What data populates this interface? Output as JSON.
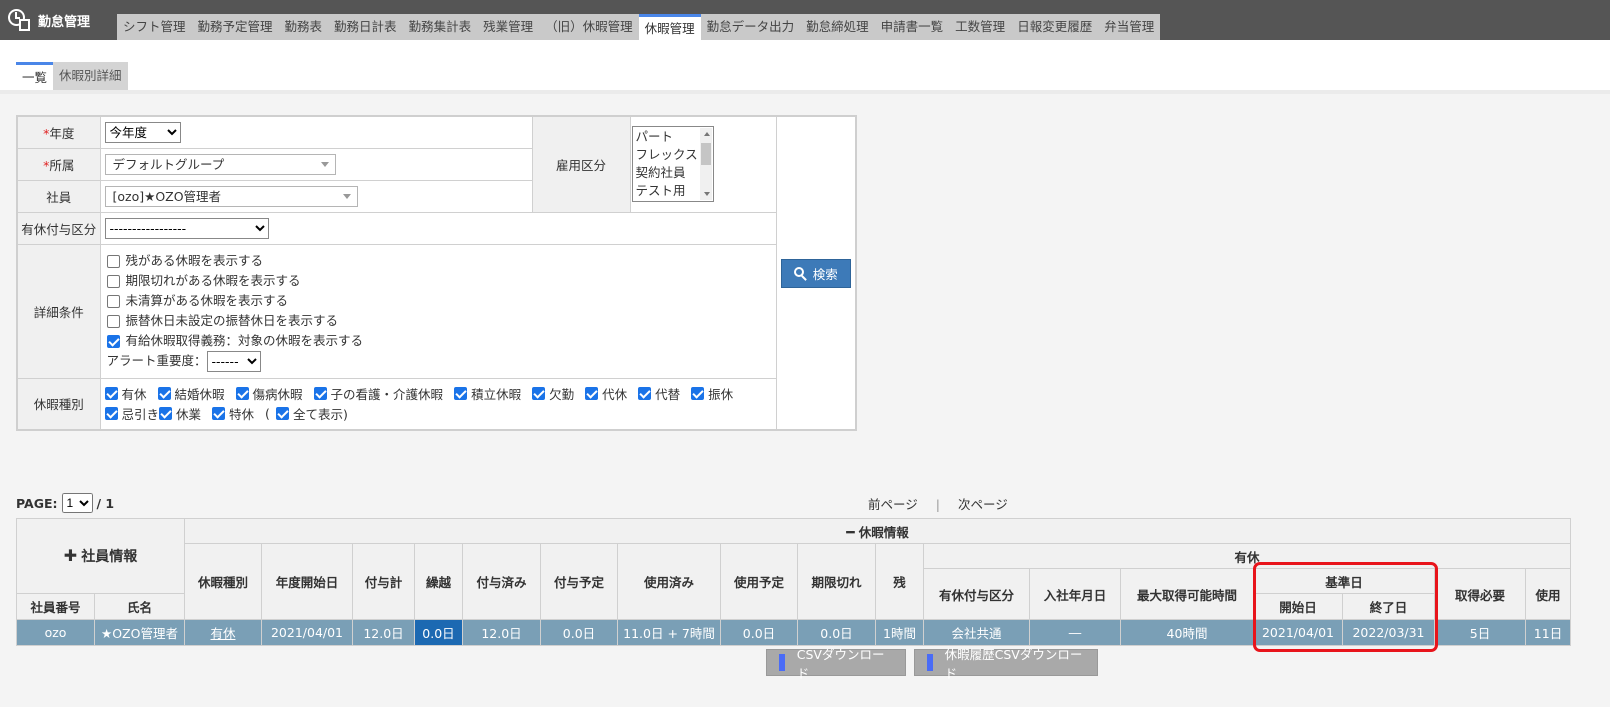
{
  "app": {
    "title": "勤怠管理",
    "icon": "clock-document-icon"
  },
  "nav": {
    "tabs": [
      {
        "label": "シフト管理",
        "active": false
      },
      {
        "label": "勤務予定管理",
        "active": false
      },
      {
        "label": "勤務表",
        "active": false
      },
      {
        "label": "勤務日計表",
        "active": false
      },
      {
        "label": "勤務集計表",
        "active": false
      },
      {
        "label": "残業管理",
        "active": false
      },
      {
        "label": "（旧）休暇管理",
        "active": false
      },
      {
        "label": "休暇管理",
        "active": true
      },
      {
        "label": "勤怠データ出力",
        "active": false
      },
      {
        "label": "勤怠締処理",
        "active": false
      },
      {
        "label": "申請書一覧",
        "active": false
      },
      {
        "label": "工数管理",
        "active": false
      },
      {
        "label": "日報変更履歴",
        "active": false
      },
      {
        "label": "弁当管理",
        "active": false
      }
    ]
  },
  "subtabs": [
    {
      "label": "一覧",
      "active": true
    },
    {
      "label": "休暇別詳細",
      "active": false
    }
  ],
  "form": {
    "required_mark": "*",
    "year_label": "年度",
    "year_value": "今年度",
    "dept_label": "所属",
    "dept_value": "デフォルトグループ",
    "employee_label": "社員",
    "employee_value": "[ozo]★OZO管理者",
    "grant_label": "有休付与区分",
    "grant_value": "-----------------",
    "employment_label": "雇用区分",
    "employment_options": [
      "パート",
      "フレックス",
      "契約社員",
      "テスト用"
    ],
    "detail_label": "詳細条件",
    "detail_options": [
      {
        "label": "残がある休暇を表示する",
        "checked": false
      },
      {
        "label": "期限切れがある休暇を表示する",
        "checked": false
      },
      {
        "label": "未清算がある休暇を表示する",
        "checked": false
      },
      {
        "label": "振替休日未設定の振替休日を表示する",
        "checked": false
      },
      {
        "label": "有給休暇取得義務：対象の休暇を表示する",
        "checked": true
      }
    ],
    "alert_label": "アラート重要度：",
    "alert_value": "------",
    "kind_label": "休暇種別",
    "kinds": [
      {
        "label": "有休",
        "checked": true
      },
      {
        "label": "結婚休暇",
        "checked": true
      },
      {
        "label": "傷病休暇",
        "checked": true
      },
      {
        "label": "子の看護・介護休暇",
        "checked": true
      },
      {
        "label": "積立休暇",
        "checked": true
      },
      {
        "label": "欠勤",
        "checked": true
      },
      {
        "label": "代休",
        "checked": true
      },
      {
        "label": "代替",
        "checked": true
      },
      {
        "label": "振休",
        "checked": true
      },
      {
        "label": "忌引き",
        "checked": true
      },
      {
        "label": "休業",
        "checked": true
      },
      {
        "label": "特休",
        "checked": true
      }
    ],
    "show_all_open": "(",
    "show_all_label": "全て表示)",
    "show_all_checked": true,
    "search_label": "検索"
  },
  "paging": {
    "label": "PAGE:",
    "current": "1",
    "total": "/ 1",
    "prev": "前ページ",
    "sep": "|",
    "next": "次ページ"
  },
  "table": {
    "employee_group": "社員情報",
    "leave_group": "休暇情報",
    "paid_group": "有休",
    "base_date_group": "基準日",
    "headers": {
      "emp_no": "社員番号",
      "name": "氏名",
      "kind": "休暇種別",
      "year_start": "年度開始日",
      "granted_total": "付与計",
      "carry_over": "繰越",
      "granted": "付与済み",
      "grant_planned": "付与予定",
      "used": "使用済み",
      "use_planned": "使用予定",
      "expired": "期限切れ",
      "remaining": "残",
      "grant_type": "有休付与区分",
      "hire_date": "入社年月日",
      "max_hours": "最大取得可能時間",
      "start_date": "開始日",
      "end_date": "終了日",
      "required": "取得必要",
      "use": "使用"
    },
    "rows": [
      {
        "emp_no": "ozo",
        "name": "★OZO管理者",
        "kind": "有休",
        "year_start": "2021/04/01",
        "granted_total": "12.0日",
        "carry_over": "0.0日",
        "granted": "12.0日",
        "grant_planned": "0.0日",
        "used": "11.0日 + 7時間",
        "use_planned": "0.0日",
        "expired": "0.0日",
        "remaining": "1時間",
        "grant_type": "会社共通",
        "hire_date": "―",
        "max_hours": "40時間",
        "start_date": "2021/04/01",
        "end_date": "2022/03/31",
        "required": "5日",
        "use": "11日"
      }
    ]
  },
  "buttons": {
    "csv": "CSVダウンロード",
    "history_csv": "休暇履歴CSVダウンロード"
  },
  "colors": {
    "topbar": "#555555",
    "accent": "#4a86e8",
    "row_bg": "#7a9fb6",
    "carry_highlight": "#1c69b2",
    "search_button": "#3d7ab8",
    "annotation": "#e8141b"
  }
}
